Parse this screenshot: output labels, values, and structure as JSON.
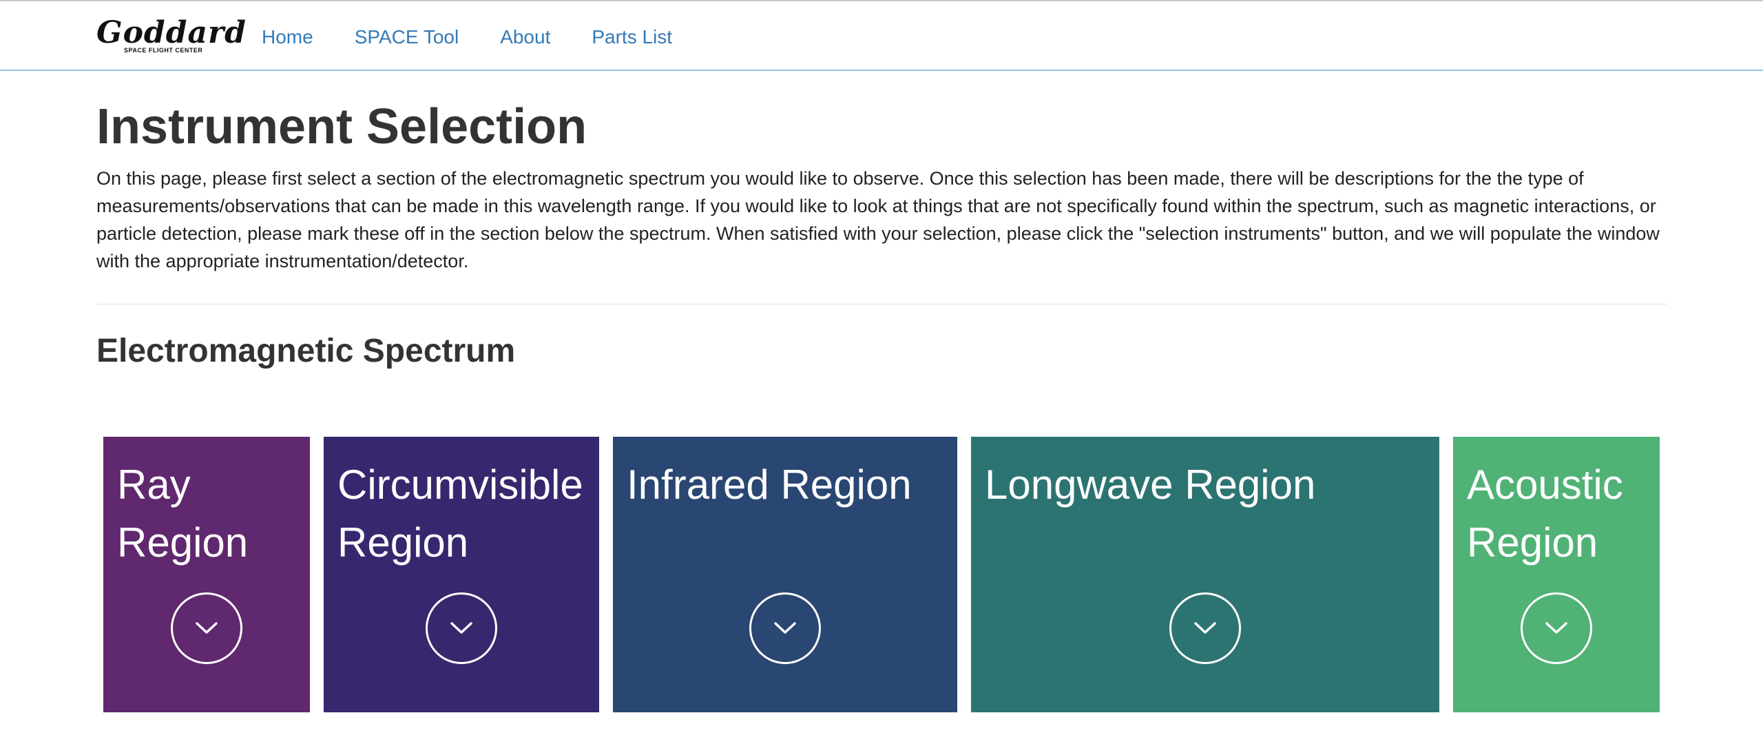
{
  "navbar": {
    "logo_text": "Goddard",
    "logo_subtext": "SPACE FLIGHT CENTER",
    "links": [
      "Home",
      "SPACE Tool",
      "About",
      "Parts List"
    ],
    "link_color": "#337ab7"
  },
  "page": {
    "title": "Instrument Selection",
    "intro": "On this page, please first select a section of the electromagnetic spectrum you would like to observe. Once this selection has been made, there will be descriptions for the the type of measurements/observations that can be made in this wavelength range. If you would like to look at things that are not specifically found within the spectrum, such as magnetic interactions, or particle detection, please mark these off in the section below the spectrum. When satisfied with your selection, please click the \"selection instruments\" button, and we will populate the window with the appropriate instrumentation/detector.",
    "section_title": "Electromagnetic Spectrum"
  },
  "regions": [
    {
      "label": "Ray Region",
      "color": "#60286e",
      "icon": "chevron-down-icon"
    },
    {
      "label": "Circumvisible Region",
      "color": "#36276e",
      "icon": "chevron-down-icon"
    },
    {
      "label": "Infrared Region",
      "color": "#2a4672",
      "icon": "chevron-down-icon"
    },
    {
      "label": "Longwave Region",
      "color": "#2c7472",
      "icon": "chevron-down-icon"
    },
    {
      "label": "Acoustic Region",
      "color": "#51b276",
      "icon": "chevron-down-icon"
    }
  ]
}
